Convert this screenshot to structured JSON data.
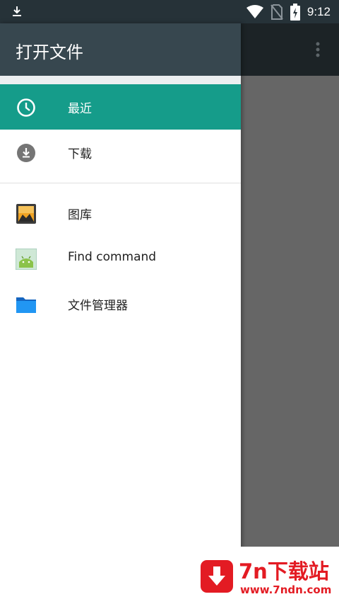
{
  "status_bar": {
    "time": "9:12",
    "icons": [
      "download-icon",
      "wifi-icon",
      "no-sim-icon",
      "battery-charging-icon"
    ]
  },
  "drawer": {
    "title": "打开文件",
    "items": [
      {
        "label": "最近",
        "icon": "clock-icon",
        "selected": true
      },
      {
        "label": "下载",
        "icon": "download-circle-icon",
        "selected": false
      },
      {
        "label": "图库",
        "icon": "gallery-icon",
        "selected": false
      },
      {
        "label": "Find command",
        "icon": "android-app-icon",
        "selected": false
      },
      {
        "label": "文件管理器",
        "icon": "folder-icon",
        "selected": false
      }
    ]
  },
  "watermark": {
    "title": "7n下载站",
    "url": "www.7ndn.com"
  },
  "colors": {
    "accent": "#159c8a",
    "header": "#37474f",
    "status_bar": "#263238",
    "scrim": "#666666",
    "watermark_red": "#e31b23"
  }
}
